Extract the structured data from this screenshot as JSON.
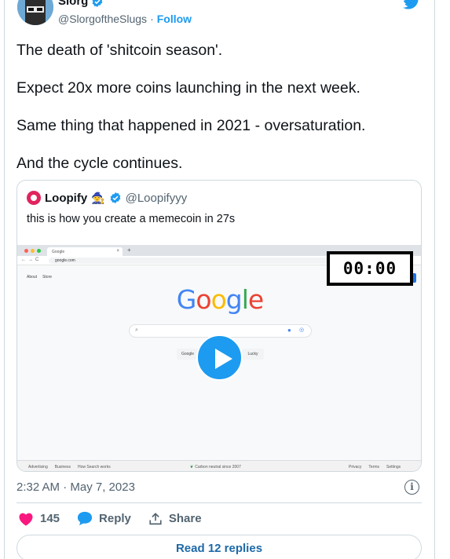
{
  "author": {
    "display_name": "Slorg",
    "handle": "@SlorgoftheSlugs",
    "separator": "·",
    "follow_label": "Follow"
  },
  "tweet": {
    "paragraphs": [
      "The death of 'shitcoin season'.",
      "Expect 20x more coins launching in the next week.",
      "Same thing that happened in 2021 - oversaturation.",
      "And the cycle continues."
    ]
  },
  "quote": {
    "display_name": "Loopify",
    "emoji": "🧙",
    "handle": "@Loopifyyy",
    "text": "this is how you create a memecoin in 27s",
    "video": {
      "timer": "00:00",
      "browser": {
        "tab_title": "Google",
        "url": "google.com",
        "top_links": [
          "About",
          "Store"
        ],
        "logo_letters": [
          {
            "char": "G",
            "color": "#4285f4"
          },
          {
            "char": "o",
            "color": "#ea4335"
          },
          {
            "char": "o",
            "color": "#fbbc05"
          },
          {
            "char": "g",
            "color": "#4285f4"
          },
          {
            "char": "l",
            "color": "#34a853"
          },
          {
            "char": "e",
            "color": "#ea4335"
          }
        ],
        "search_button": "Google",
        "lucky_button": "Lucky",
        "footer_left": [
          "Advertising",
          "Business",
          "How Search works"
        ],
        "footer_mid": "Carbon neutral since 2007",
        "footer_right": [
          "Privacy",
          "Terms",
          "Settings"
        ]
      }
    }
  },
  "meta": {
    "timestamp": "2:32 AM · May 7, 2023",
    "info_icon": "i"
  },
  "actions": {
    "like_count": "145",
    "reply_label": "Reply",
    "share_label": "Share"
  },
  "read_replies_label": "Read 12 replies",
  "colors": {
    "accent": "#1d9bf0",
    "like": "#f91880",
    "text": "#0f1419",
    "muted": "#536471"
  },
  "icons": [
    "verified-badge-icon",
    "twitter-bird-icon",
    "info-icon",
    "heart-icon",
    "reply-bubble-icon",
    "share-icon",
    "play-icon"
  ]
}
